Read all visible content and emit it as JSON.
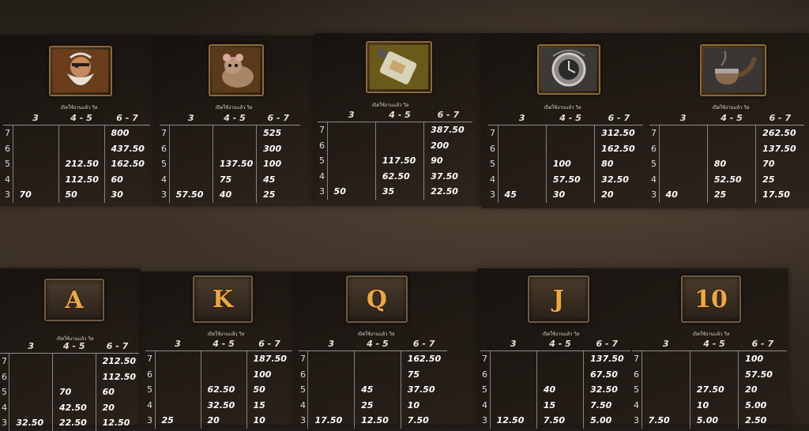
{
  "header_cols": [
    "3",
    "4 - 5",
    "6 - 7"
  ],
  "cards": [
    {
      "icon": "dwarf-portrait-icon",
      "type": "pic",
      "note": "เปิดใช้งานแล้ว วิล",
      "rows": [
        {
          "n": "7",
          "c": [
            "",
            "",
            "800"
          ]
        },
        {
          "n": "6",
          "c": [
            "",
            "",
            "437.50"
          ]
        },
        {
          "n": "5",
          "c": [
            "",
            "212.50",
            "162.50"
          ]
        },
        {
          "n": "4",
          "c": [
            "",
            "112.50",
            "60"
          ]
        },
        {
          "n": "3",
          "c": [
            "70",
            "50",
            "30"
          ]
        }
      ]
    },
    {
      "icon": "rat-icon",
      "type": "pic",
      "note": "เปิดใช้งานแล้ว วิล",
      "rows": [
        {
          "n": "7",
          "c": [
            "",
            "",
            "525"
          ]
        },
        {
          "n": "6",
          "c": [
            "",
            "",
            "300"
          ]
        },
        {
          "n": "5",
          "c": [
            "",
            "137.50",
            "100"
          ]
        },
        {
          "n": "4",
          "c": [
            "",
            "75",
            "45"
          ]
        },
        {
          "n": "3",
          "c": [
            "57.50",
            "40",
            "25"
          ]
        }
      ]
    },
    {
      "icon": "bottle-icon",
      "type": "pic",
      "note": "เปิดใช้งานแล้ว วิล",
      "rows": [
        {
          "n": "7",
          "c": [
            "",
            "",
            "387.50"
          ]
        },
        {
          "n": "6",
          "c": [
            "",
            "",
            "200"
          ]
        },
        {
          "n": "5",
          "c": [
            "",
            "117.50",
            "90"
          ]
        },
        {
          "n": "4",
          "c": [
            "",
            "62.50",
            "37.50"
          ]
        },
        {
          "n": "3",
          "c": [
            "50",
            "35",
            "22.50"
          ]
        }
      ]
    },
    {
      "icon": "pocket-watch-icon",
      "type": "pic",
      "note": "เปิดใช้งานแล้ว วิล",
      "rows": [
        {
          "n": "7",
          "c": [
            "",
            "",
            "312.50"
          ]
        },
        {
          "n": "6",
          "c": [
            "",
            "",
            "162.50"
          ]
        },
        {
          "n": "5",
          "c": [
            "",
            "100",
            "80"
          ]
        },
        {
          "n": "4",
          "c": [
            "",
            "57.50",
            "32.50"
          ]
        },
        {
          "n": "3",
          "c": [
            "45",
            "30",
            "20"
          ]
        }
      ]
    },
    {
      "icon": "smoking-pipe-icon",
      "type": "pic",
      "note": "เปิดใช้งานแล้ว วิล",
      "rows": [
        {
          "n": "7",
          "c": [
            "",
            "",
            "262.50"
          ]
        },
        {
          "n": "6",
          "c": [
            "",
            "",
            "137.50"
          ]
        },
        {
          "n": "5",
          "c": [
            "",
            "80",
            "70"
          ]
        },
        {
          "n": "4",
          "c": [
            "",
            "52.50",
            "25"
          ]
        },
        {
          "n": "3",
          "c": [
            "40",
            "25",
            "17.50"
          ]
        }
      ]
    },
    {
      "icon": "letter-a-icon",
      "type": "letter",
      "glyph": "A",
      "note": "เปิดใช้งานแล้ว วิล",
      "rows": [
        {
          "n": "7",
          "c": [
            "",
            "",
            "212.50"
          ]
        },
        {
          "n": "6",
          "c": [
            "",
            "",
            "112.50"
          ]
        },
        {
          "n": "5",
          "c": [
            "",
            "70",
            "60"
          ]
        },
        {
          "n": "4",
          "c": [
            "",
            "42.50",
            "20"
          ]
        },
        {
          "n": "3",
          "c": [
            "32.50",
            "22.50",
            "12.50"
          ]
        }
      ]
    },
    {
      "icon": "letter-k-icon",
      "type": "letter",
      "glyph": "K",
      "note": "เปิดใช้งานแล้ว วิล",
      "rows": [
        {
          "n": "7",
          "c": [
            "",
            "",
            "187.50"
          ]
        },
        {
          "n": "6",
          "c": [
            "",
            "",
            "100"
          ]
        },
        {
          "n": "5",
          "c": [
            "",
            "62.50",
            "50"
          ]
        },
        {
          "n": "4",
          "c": [
            "",
            "32.50",
            "15"
          ]
        },
        {
          "n": "3",
          "c": [
            "25",
            "20",
            "10"
          ]
        }
      ]
    },
    {
      "icon": "letter-q-icon",
      "type": "letter",
      "glyph": "Q",
      "note": "เปิดใช้งานแล้ว วิล",
      "rows": [
        {
          "n": "7",
          "c": [
            "",
            "",
            "162.50"
          ]
        },
        {
          "n": "6",
          "c": [
            "",
            "",
            "75"
          ]
        },
        {
          "n": "5",
          "c": [
            "",
            "45",
            "37.50"
          ]
        },
        {
          "n": "4",
          "c": [
            "",
            "25",
            "10"
          ]
        },
        {
          "n": "3",
          "c": [
            "17.50",
            "12.50",
            "7.50"
          ]
        }
      ]
    },
    {
      "icon": "letter-j-icon",
      "type": "letter",
      "glyph": "J",
      "note": "เปิดใช้งานแล้ว วิล",
      "rows": [
        {
          "n": "7",
          "c": [
            "",
            "",
            "137.50"
          ]
        },
        {
          "n": "6",
          "c": [
            "",
            "",
            "67.50"
          ]
        },
        {
          "n": "5",
          "c": [
            "",
            "40",
            "32.50"
          ]
        },
        {
          "n": "4",
          "c": [
            "",
            "15",
            "7.50"
          ]
        },
        {
          "n": "3",
          "c": [
            "12.50",
            "7.50",
            "5.00"
          ]
        }
      ]
    },
    {
      "icon": "number-10-icon",
      "type": "letter",
      "glyph": "10",
      "note": "เปิดใช้งานแล้ว วิล",
      "rows": [
        {
          "n": "7",
          "c": [
            "",
            "",
            "100"
          ]
        },
        {
          "n": "6",
          "c": [
            "",
            "",
            "57.50"
          ]
        },
        {
          "n": "5",
          "c": [
            "",
            "27.50",
            "20"
          ]
        },
        {
          "n": "4",
          "c": [
            "",
            "10",
            "5.00"
          ]
        },
        {
          "n": "3",
          "c": [
            "7.50",
            "5.00",
            "2.50"
          ]
        }
      ]
    }
  ]
}
